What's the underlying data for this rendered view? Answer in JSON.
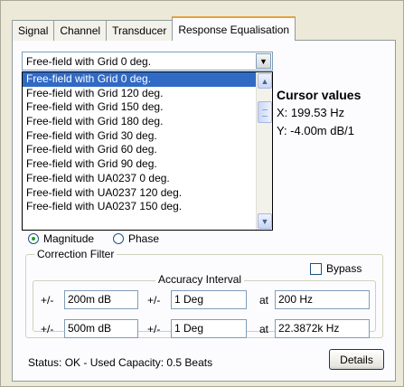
{
  "tabs": [
    {
      "label": "Signal"
    },
    {
      "label": "Channel"
    },
    {
      "label": "Transducer"
    },
    {
      "label": "Response Equalisation"
    }
  ],
  "combo": {
    "value": "Free-field with Grid 0 deg."
  },
  "list": {
    "items": [
      "Free-field with Grid 0 deg.",
      "Free-field with Grid 120 deg.",
      "Free-field with Grid 150 deg.",
      "Free-field with Grid 180 deg.",
      "Free-field with Grid 30 deg.",
      "Free-field with Grid 60 deg.",
      "Free-field with Grid 90 deg.",
      "Free-field with UA0237 0 deg.",
      "Free-field with UA0237 120 deg.",
      "Free-field with UA0237 150 deg."
    ],
    "selected_index": 0
  },
  "cursor": {
    "title": "Cursor values",
    "x": "X: 199.53 Hz",
    "y": "Y: -4.00m dB/1"
  },
  "radio": {
    "magnitude": "Magnitude",
    "phase": "Phase"
  },
  "correction_filter": {
    "title": "Correction Filter",
    "bypass_label": "Bypass",
    "accuracy_title": "Accuracy Interval",
    "rows": [
      {
        "pm1": "+/-",
        "db": "200m dB",
        "pm2": "+/-",
        "deg": "1 Deg",
        "at": "at",
        "freq": "200 Hz"
      },
      {
        "pm1": "+/-",
        "db": "500m dB",
        "pm2": "+/-",
        "deg": "1 Deg",
        "at": "at",
        "freq": "22.3872k Hz"
      }
    ]
  },
  "status": {
    "text": "Status: OK - Used Capacity: 0.5 Beats"
  },
  "details_button": {
    "label": "Details"
  }
}
